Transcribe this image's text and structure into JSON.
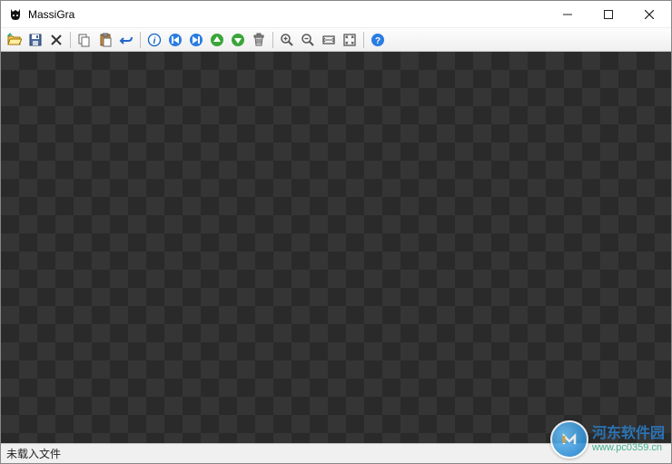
{
  "titlebar": {
    "app_name": "MassiGra"
  },
  "toolbar": {
    "tooltips": {
      "open": "Open",
      "save": "Save",
      "delete": "Delete",
      "copy": "Copy",
      "paste": "Paste",
      "undo": "Undo",
      "info": "Info",
      "first": "First",
      "last": "Last",
      "prev_folder": "Previous Folder",
      "next_folder": "Next Folder",
      "recycle": "Recycle",
      "zoom_in": "Zoom In",
      "zoom_out": "Zoom Out",
      "actual_size": "Actual Size",
      "fit": "Fit to Window",
      "help": "Help"
    }
  },
  "statusbar": {
    "message": "未载入文件"
  },
  "watermark": {
    "line1": "河东软件园",
    "line2": "www.pc0359.cn"
  }
}
